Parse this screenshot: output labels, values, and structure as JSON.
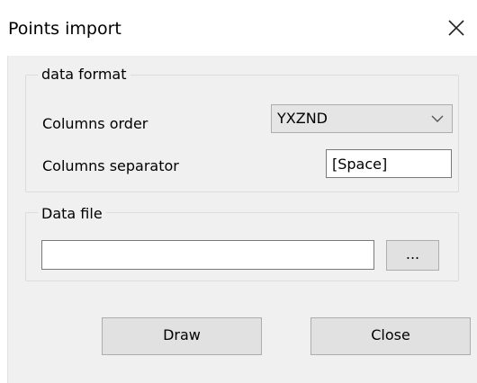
{
  "window": {
    "title": "Points import"
  },
  "data_format": {
    "legend": "data format",
    "columns_order_label": "Columns order",
    "columns_order_value": "YXZND",
    "columns_separator_label": "Columns separator",
    "columns_separator_value": "[Space]"
  },
  "data_file": {
    "legend": "Data file",
    "path_value": "",
    "browse_label": "..."
  },
  "buttons": {
    "draw_label": "Draw",
    "close_label": "Close"
  },
  "icons": {
    "close": "close-icon",
    "dropdown": "chevron-down-icon"
  }
}
